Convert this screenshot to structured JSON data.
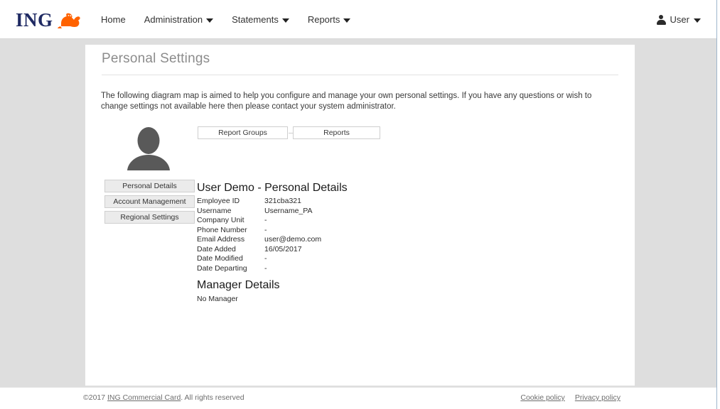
{
  "brand": {
    "logo_text": "ING",
    "logo_icon": "ing-lion-icon",
    "accent_color": "#ff6200",
    "logo_color": "#1f2a63"
  },
  "nav": {
    "items": [
      {
        "label": "Home",
        "has_caret": false
      },
      {
        "label": "Administration",
        "has_caret": true
      },
      {
        "label": "Statements",
        "has_caret": true
      },
      {
        "label": "Reports",
        "has_caret": true
      }
    ]
  },
  "user_menu": {
    "label": "User",
    "icon": "person-icon",
    "caret": "chevron-down-icon"
  },
  "page": {
    "title": "Personal Settings",
    "intro": "The following diagram map is aimed to help you configure and manage your own personal settings. If you have any questions or wish to change settings not available here then please contact your system administrator."
  },
  "diagram": {
    "avatar_icon": "user-silhouette-icon",
    "boxes": [
      {
        "label": "Report Groups"
      },
      {
        "label": "Reports"
      }
    ]
  },
  "side_nav": {
    "items": [
      {
        "label": "Personal Details"
      },
      {
        "label": "Account Management"
      },
      {
        "label": "Regional Settings"
      }
    ]
  },
  "details": {
    "heading": "User Demo - Personal Details",
    "rows": [
      {
        "key": "Employee ID",
        "value": "321cba321"
      },
      {
        "key": "Username",
        "value": "Username_PA"
      },
      {
        "key": "Company Unit",
        "value": "-"
      },
      {
        "key": "Phone Number",
        "value": "-"
      },
      {
        "key": "Email Address",
        "value": "user@demo.com"
      },
      {
        "key": "Date Added",
        "value": "16/05/2017"
      },
      {
        "key": "Date Modified",
        "value": "-"
      },
      {
        "key": "Date Departing",
        "value": "-"
      }
    ]
  },
  "manager": {
    "heading": "Manager Details",
    "text": "No Manager"
  },
  "footer": {
    "copyright_prefix": "©2017 ",
    "company_link": "ING Commercial Card",
    "copyright_suffix": ". All rights reserved",
    "links": [
      {
        "label": "Cookie policy"
      },
      {
        "label": "Privacy policy"
      }
    ]
  }
}
